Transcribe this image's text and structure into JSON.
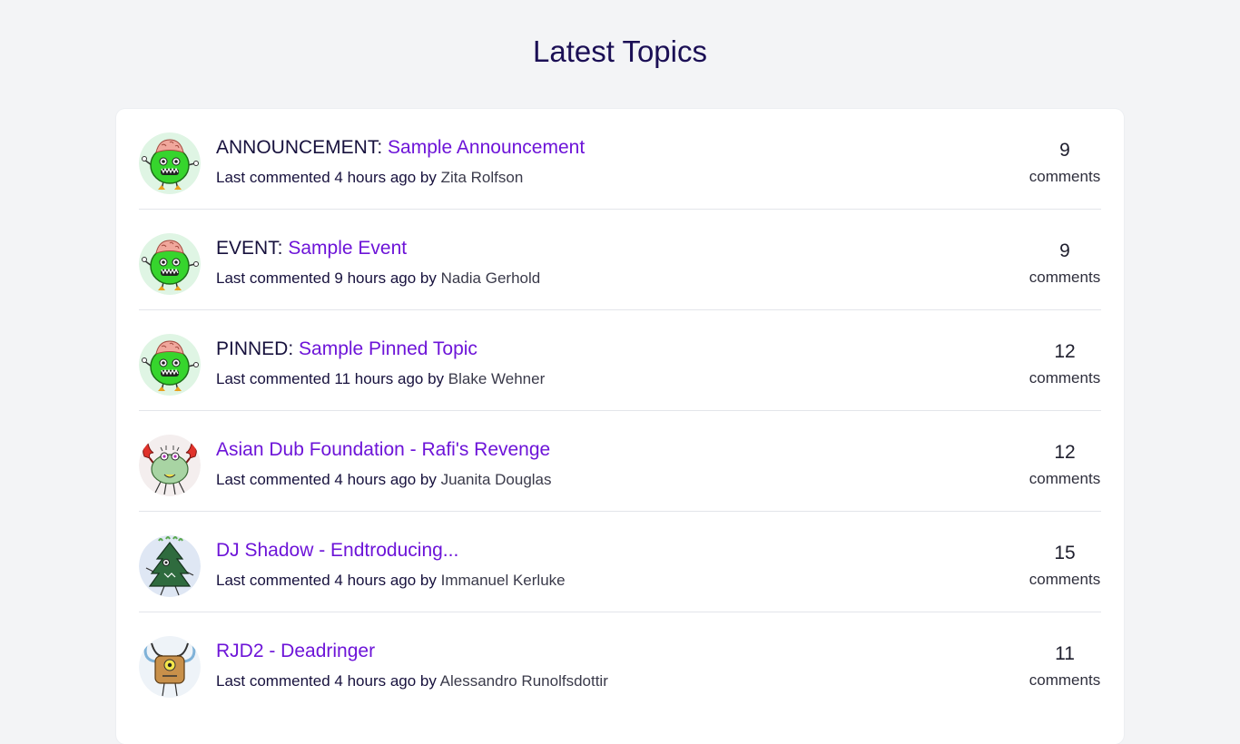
{
  "page": {
    "title": "Latest Topics"
  },
  "topics": [
    {
      "prefix": "ANNOUNCEMENT: ",
      "title": "Sample Announcement",
      "meta_prefix": "Last commented 4 hours ago by ",
      "author": "Zita Rolfson",
      "count": "9",
      "count_label": "comments",
      "avatar_icon": "green-monster-avatar-icon"
    },
    {
      "prefix": "EVENT: ",
      "title": "Sample Event",
      "meta_prefix": "Last commented 9 hours ago by ",
      "author": "Nadia Gerhold",
      "count": "9",
      "count_label": "comments",
      "avatar_icon": "green-monster-avatar-icon"
    },
    {
      "prefix": "PINNED: ",
      "title": "Sample Pinned Topic",
      "meta_prefix": "Last commented 11 hours ago by ",
      "author": "Blake Wehner",
      "count": "12",
      "count_label": "comments",
      "avatar_icon": "green-monster-avatar-icon"
    },
    {
      "prefix": "",
      "title": "Asian Dub Foundation - Rafi's Revenge",
      "meta_prefix": "Last commented 4 hours ago by ",
      "author": "Juanita Douglas",
      "count": "12",
      "count_label": "comments",
      "avatar_icon": "crab-monster-avatar-icon"
    },
    {
      "prefix": "",
      "title": "DJ Shadow - Endtroducing...",
      "meta_prefix": "Last commented 4 hours ago by ",
      "author": "Immanuel Kerluke",
      "count": "15",
      "count_label": "comments",
      "avatar_icon": "tree-monster-avatar-icon"
    },
    {
      "prefix": "",
      "title": "RJD2 - Deadringer",
      "meta_prefix": "Last commented 4 hours ago by ",
      "author": "Alessandro Runolfsdottir",
      "count": "11",
      "count_label": "comments",
      "avatar_icon": "horned-monster-avatar-icon"
    }
  ],
  "colors": {
    "background": "#f3f4f6",
    "link": "#6d14d8",
    "title": "#1b0f55",
    "divider": "#e3e5ea"
  }
}
